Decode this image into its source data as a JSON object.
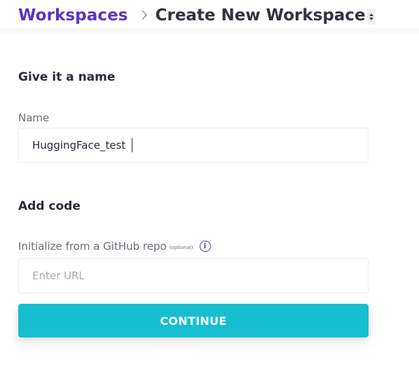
{
  "breadcrumb": {
    "root": "Workspaces",
    "current": "Create New Workspace"
  },
  "sections": {
    "name_title": "Give it a name",
    "code_title": "Add code"
  },
  "name_field": {
    "label": "Name",
    "value": "HuggingFace_test"
  },
  "repo_field": {
    "label": "Initialize from a GitHub repo",
    "optional_note": "(optional)",
    "info_glyph": "i",
    "placeholder": "Enter URL",
    "value": ""
  },
  "continue_button": {
    "label": "CONTINUE"
  },
  "icons": {
    "breadcrumb_separator": "chevron-right-icon",
    "title_toggle": "sort-icon",
    "repo_info": "info-icon"
  },
  "colors": {
    "brand_purple": "#5b34c4",
    "button_teal": "#16bfcf",
    "text_dark": "#2b2b3a",
    "text_muted": "#6d6d78",
    "border": "#ececf0"
  }
}
